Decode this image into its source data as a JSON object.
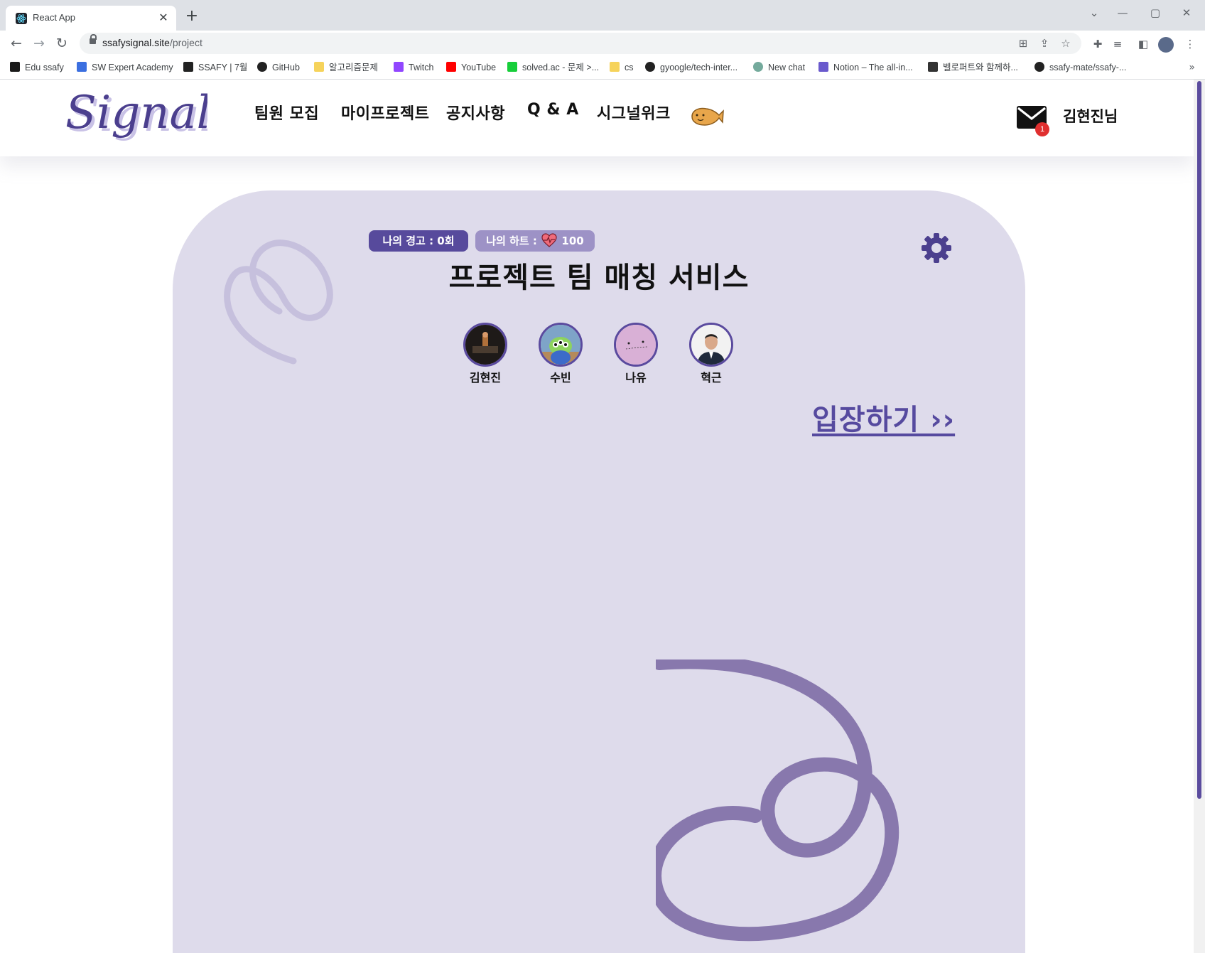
{
  "browser": {
    "tab_title": "React App",
    "url_host": "ssafysignal.site",
    "url_path": "/project",
    "bookmarks": [
      {
        "label": "Edu ssafy",
        "color": "#1a1a1a"
      },
      {
        "label": "SW Expert Academy",
        "color": "#3b6fe0"
      },
      {
        "label": "SSAFY | 7월",
        "color": "#222222"
      },
      {
        "label": "GitHub",
        "color": "#222222"
      },
      {
        "label": "알고리즘문제",
        "color": "#f6d35b"
      },
      {
        "label": "Twitch",
        "color": "#9146ff"
      },
      {
        "label": "YouTube",
        "color": "#ff0000"
      },
      {
        "label": "solved.ac - 문제 >...",
        "color": "#17ce3a"
      },
      {
        "label": "cs",
        "color": "#f6d35b"
      },
      {
        "label": "gyoogle/tech-inter...",
        "color": "#222222"
      },
      {
        "label": "New chat",
        "color": "#74aa9c"
      },
      {
        "label": "Notion – The all-in...",
        "color": "#6a5acd"
      },
      {
        "label": "벨로퍼트와 함께하...",
        "color": "#333333"
      },
      {
        "label": "ssafy-mate/ssafy-...",
        "color": "#222222"
      }
    ]
  },
  "header": {
    "logo_text": "Signal",
    "menu": [
      "팀원 모집",
      "마이프로젝트",
      "공지사항",
      "Q & A",
      "시그널위크"
    ],
    "mail_badge": "1",
    "username": "김현진님"
  },
  "project": {
    "warning_label": "나의 경고 : 0회",
    "heart_label": "나의 하트 :",
    "heart_value": "100",
    "title": "프로젝트 팀 매칭 서비스",
    "members": [
      "김현진",
      "수빈",
      "나유",
      "혁근"
    ],
    "enter_label": "입장하기 ››"
  },
  "colors": {
    "brand": "#564a9f",
    "card_bg": "#dedbeb",
    "pill_warn": "#574a9c",
    "pill_heart": "#9d92c6",
    "badge": "#e02f2f"
  }
}
